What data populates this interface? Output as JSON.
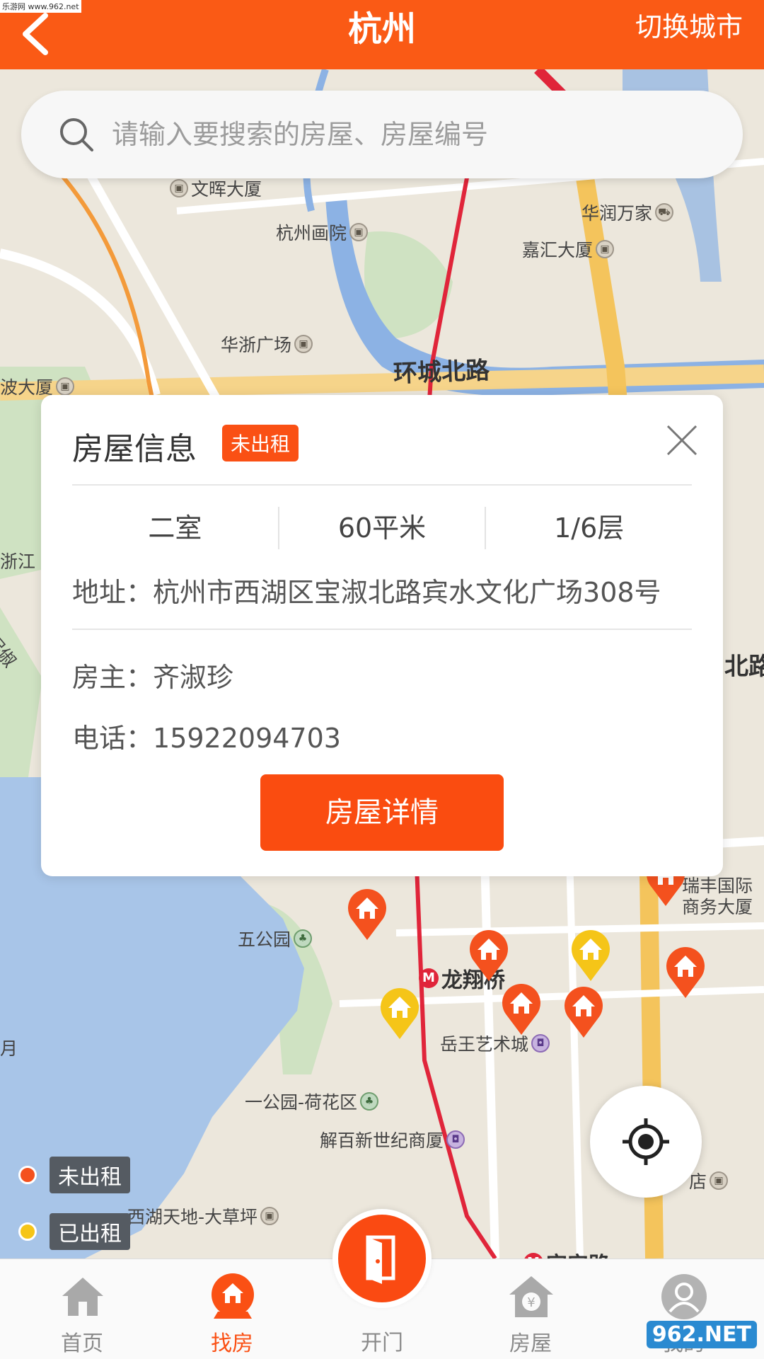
{
  "header": {
    "title": "杭州",
    "switch_city": "切换城市",
    "watermark": "乐游网 www.962.net"
  },
  "search": {
    "placeholder": "请输入要搜索的房屋、房屋编号"
  },
  "map": {
    "pois": [
      "文晖大厦",
      "杭州画院",
      "华润万家",
      "嘉汇大厦",
      "华浙广场",
      "波大厦",
      "五公园",
      "岳王艺术城",
      "一公园-荷花区",
      "解百新世纪商厦",
      "西湖天地-大草坪",
      "瑞丰国际",
      "商务大厦",
      "店",
      "浙江",
      "保俶",
      "月"
    ],
    "roads": [
      "环城北路",
      "北路"
    ],
    "metro": [
      "龙翔桥",
      "定安路"
    ],
    "pins": [
      {
        "status": "unrented"
      },
      {
        "status": "unrented"
      },
      {
        "status": "rented"
      },
      {
        "status": "unrented"
      },
      {
        "status": "rented"
      },
      {
        "status": "unrented"
      },
      {
        "status": "unrented"
      },
      {
        "status": "unrented"
      },
      {
        "status": "unrented"
      }
    ]
  },
  "legend": {
    "unrented": "未出租",
    "rented": "已出租",
    "unrented_color": "#f4511e",
    "rented_color": "#f5c518"
  },
  "card": {
    "title": "房屋信息",
    "status": "未出租",
    "rooms": "二室",
    "area": "60平米",
    "floor": "1/6层",
    "address_label": "地址：",
    "address": "杭州市西湖区宝淑北路宾水文化广场308号",
    "owner_label": "房主：",
    "owner": "齐淑珍",
    "phone_label": "电话：",
    "phone": "15922094703",
    "detail_button": "房屋详情"
  },
  "nav": {
    "home": "首页",
    "find": "找房",
    "door": "开门",
    "house": "房屋",
    "mine": "我的"
  },
  "watermark_br": "962.NET"
}
